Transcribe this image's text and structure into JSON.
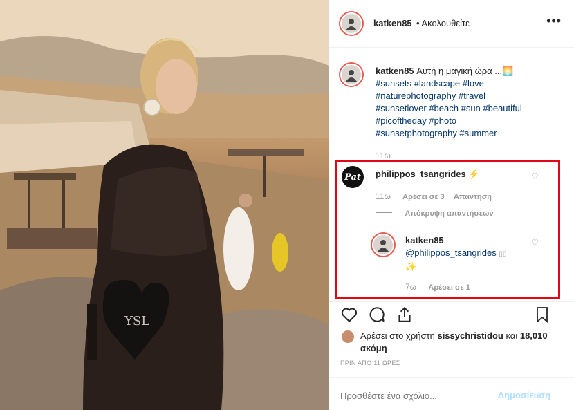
{
  "header": {
    "username": "katken85",
    "follow_status": "• Ακολουθείτε",
    "more_icon": "more-dots-icon"
  },
  "caption": {
    "username": "katken85",
    "text": "Αυτή η μαγική ώρα ...🌅",
    "hashtags": [
      "#sunsets #landscape #love",
      "#naturephotography #travel",
      "#sunsetlover #beach #sun #beautiful",
      "#picoftheday #photo",
      "#sunsetphotography #summer"
    ],
    "time": "11ω"
  },
  "comments": [
    {
      "username": "philippos_tsangrides",
      "text": "⚡",
      "avatar_text": "Pat",
      "time": "11ω",
      "likes": "Αρέσει σε 3",
      "reply": "Απάντηση",
      "hide_replies": "Απόκρυψη απαντήσεων"
    }
  ],
  "reply": {
    "username": "katken85",
    "mention": "@philippos_tsangrides",
    "text": "✨",
    "time": "7ω",
    "likes": "Αρέσει σε 1"
  },
  "actions": {
    "icons": [
      "heart-icon",
      "comment-icon",
      "share-icon",
      "bookmark-icon"
    ]
  },
  "likes": {
    "text_prefix": "Αρέσει στο χρήστη",
    "user": "sissychristidou",
    "text_mid": "και",
    "count": "18,010 ακόμη"
  },
  "timestamp": "ΠΡΙΝ ΑΠΟ 11 ΩΡΕΣ",
  "comment_box": {
    "placeholder": "Προσθέστε ένα σχόλιο...",
    "post_label": "Δημοσίευση"
  },
  "colors": {
    "link": "#003569",
    "highlight_border": "#e30613",
    "post_disabled": "#b2dffc"
  }
}
